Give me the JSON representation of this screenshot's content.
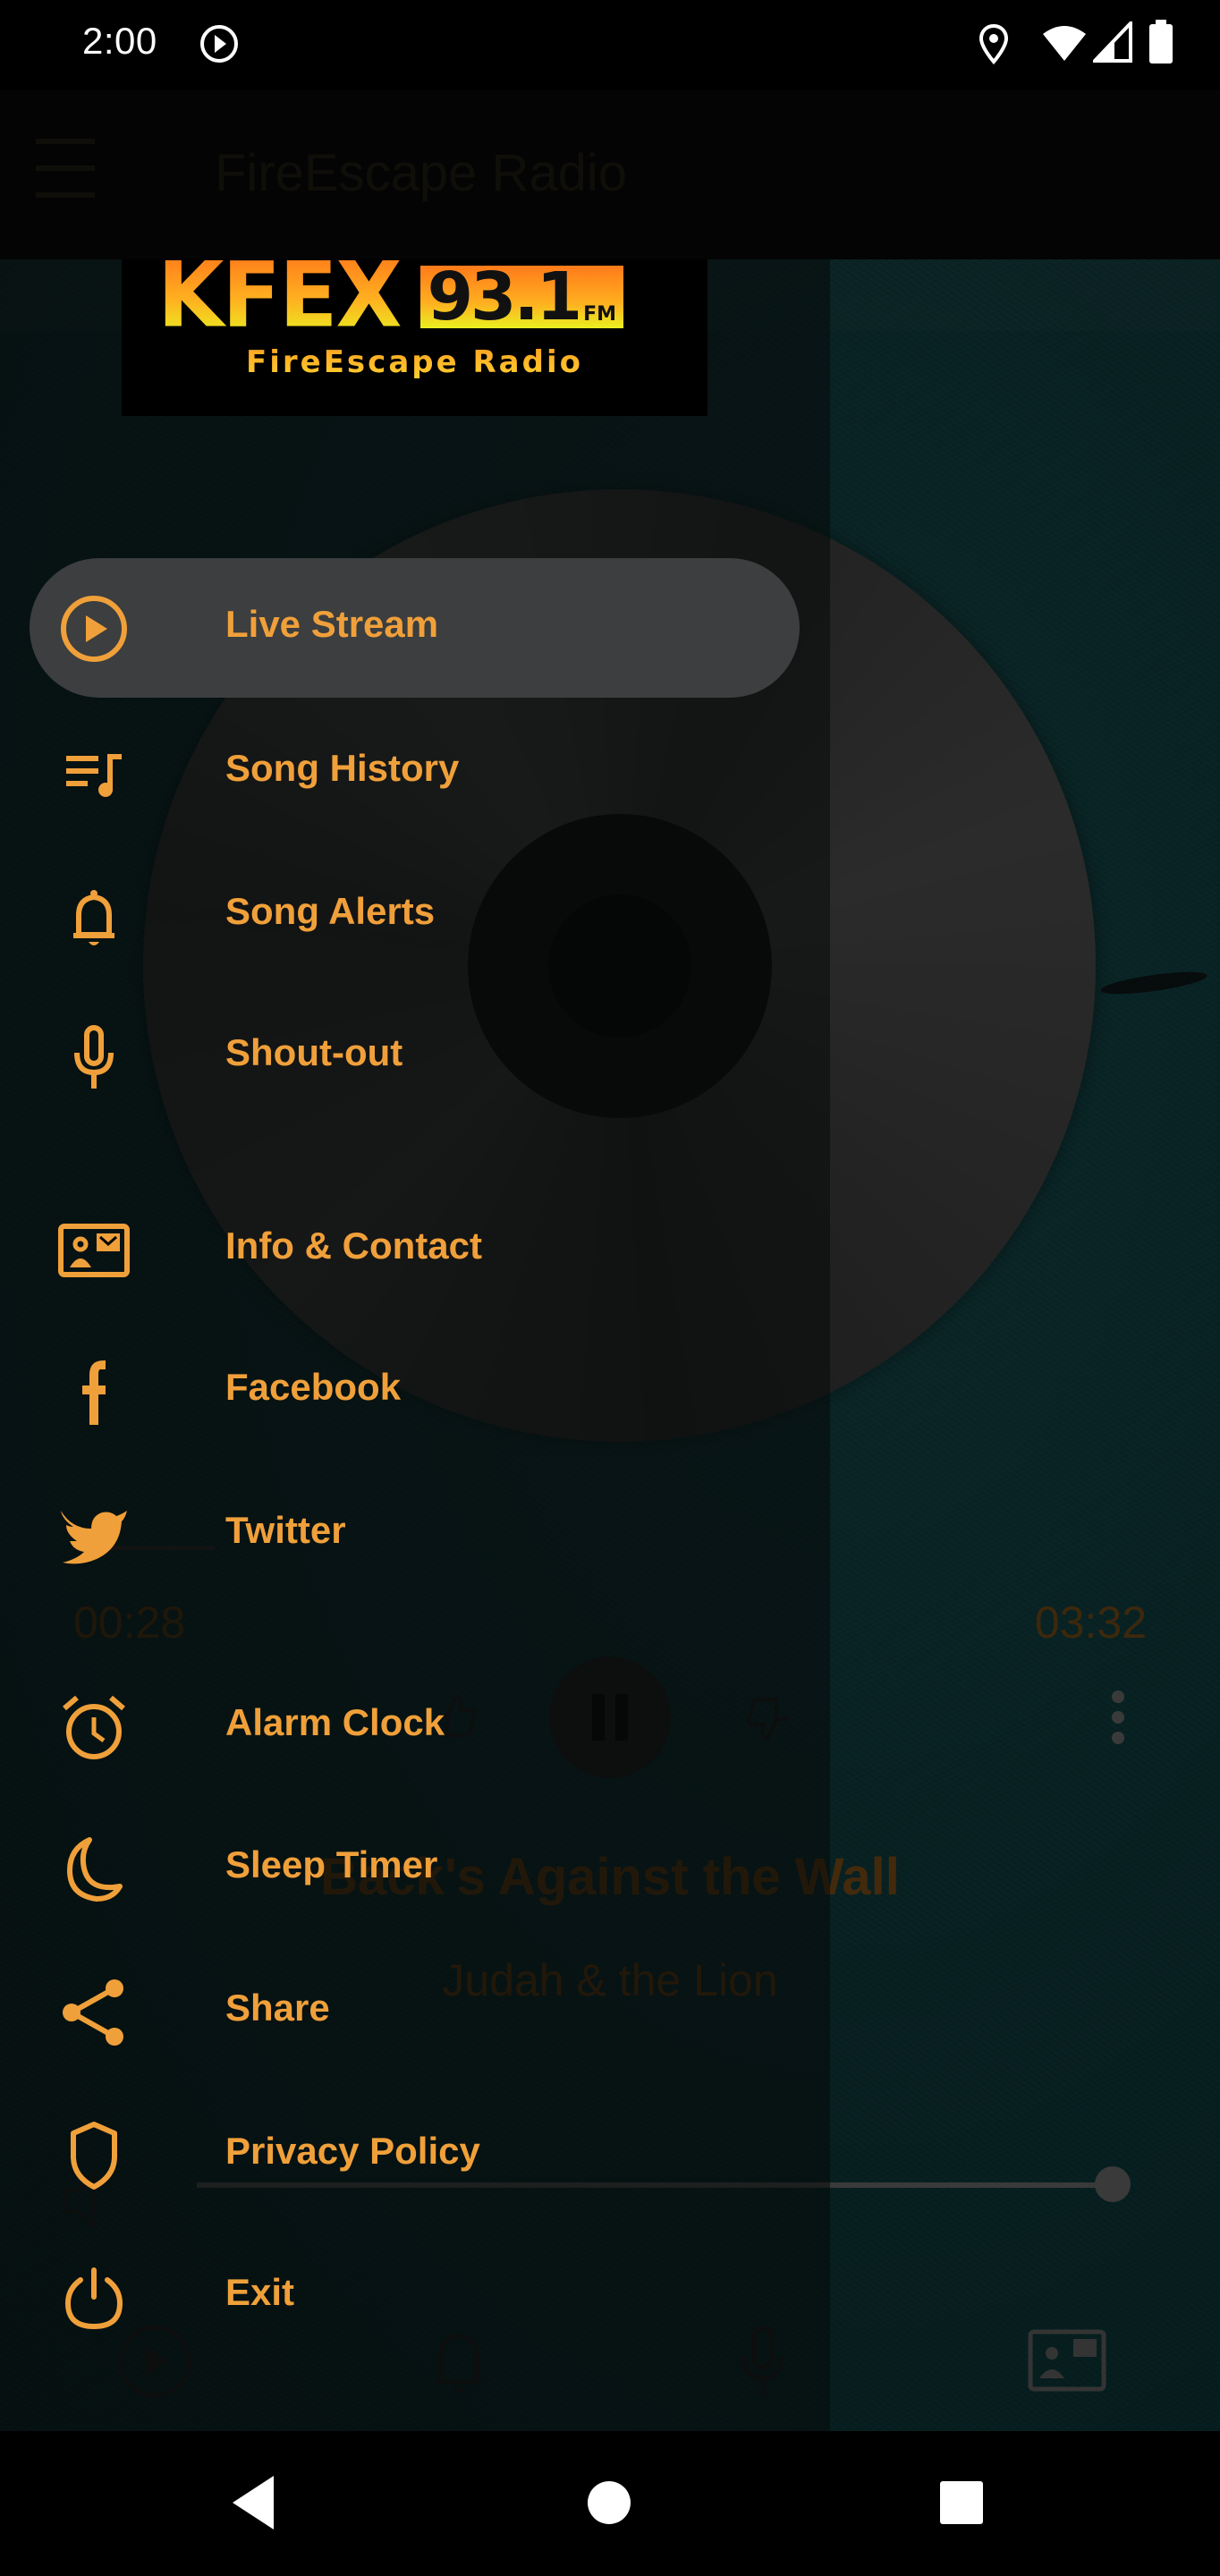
{
  "status_bar": {
    "time": "2:00",
    "icons": [
      "media-play-icon",
      "location-icon",
      "wifi-icon",
      "signal-icon",
      "battery-icon"
    ]
  },
  "app_bar": {
    "menu_icon": "hamburger-icon",
    "title": "FireEscape Radio"
  },
  "player": {
    "elapsed": "00:28",
    "duration": "03:32",
    "song_title": "Back's Against the Wall",
    "artist": "Judah & the Lion",
    "controls": [
      "thumbs-up-icon",
      "pause-icon",
      "thumbs-down-icon",
      "more-vert-icon"
    ],
    "volume_fraction": 1.0,
    "bottom_tabs": [
      "play-circle-icon",
      "bell-icon",
      "microphone-icon",
      "contact-card-icon"
    ]
  },
  "drawer": {
    "logo": {
      "call_sign": "KFEX",
      "frequency": "93.1",
      "band": "FM",
      "tagline": "FireEscape Radio"
    },
    "items": [
      {
        "label": "Live Stream",
        "icon": "play-circle-icon",
        "active": true
      },
      {
        "label": "Song History",
        "icon": "queue-music-icon",
        "active": false
      },
      {
        "label": "Song Alerts",
        "icon": "bell-icon",
        "active": false
      },
      {
        "label": "Shout-out",
        "icon": "microphone-icon",
        "active": false
      },
      {
        "label": "Info & Contact",
        "icon": "contact-card-icon",
        "active": false
      },
      {
        "label": "Facebook",
        "icon": "facebook-icon",
        "active": false
      },
      {
        "label": "Twitter",
        "icon": "twitter-icon",
        "active": false
      },
      {
        "label": "Alarm Clock",
        "icon": "alarm-clock-icon",
        "active": false
      },
      {
        "label": "Sleep Timer",
        "icon": "moon-icon",
        "active": false
      },
      {
        "label": "Share",
        "icon": "share-icon",
        "active": false
      },
      {
        "label": "Privacy Policy",
        "icon": "shield-icon",
        "active": false
      },
      {
        "label": "Exit",
        "icon": "power-icon",
        "active": false
      }
    ]
  },
  "nav_bar": {
    "buttons": [
      "back-icon",
      "home-icon",
      "recents-icon"
    ]
  },
  "colors": {
    "accent": "#F0A03A",
    "active_pill": "#3C3E3F",
    "background_teal": "#16575B"
  }
}
